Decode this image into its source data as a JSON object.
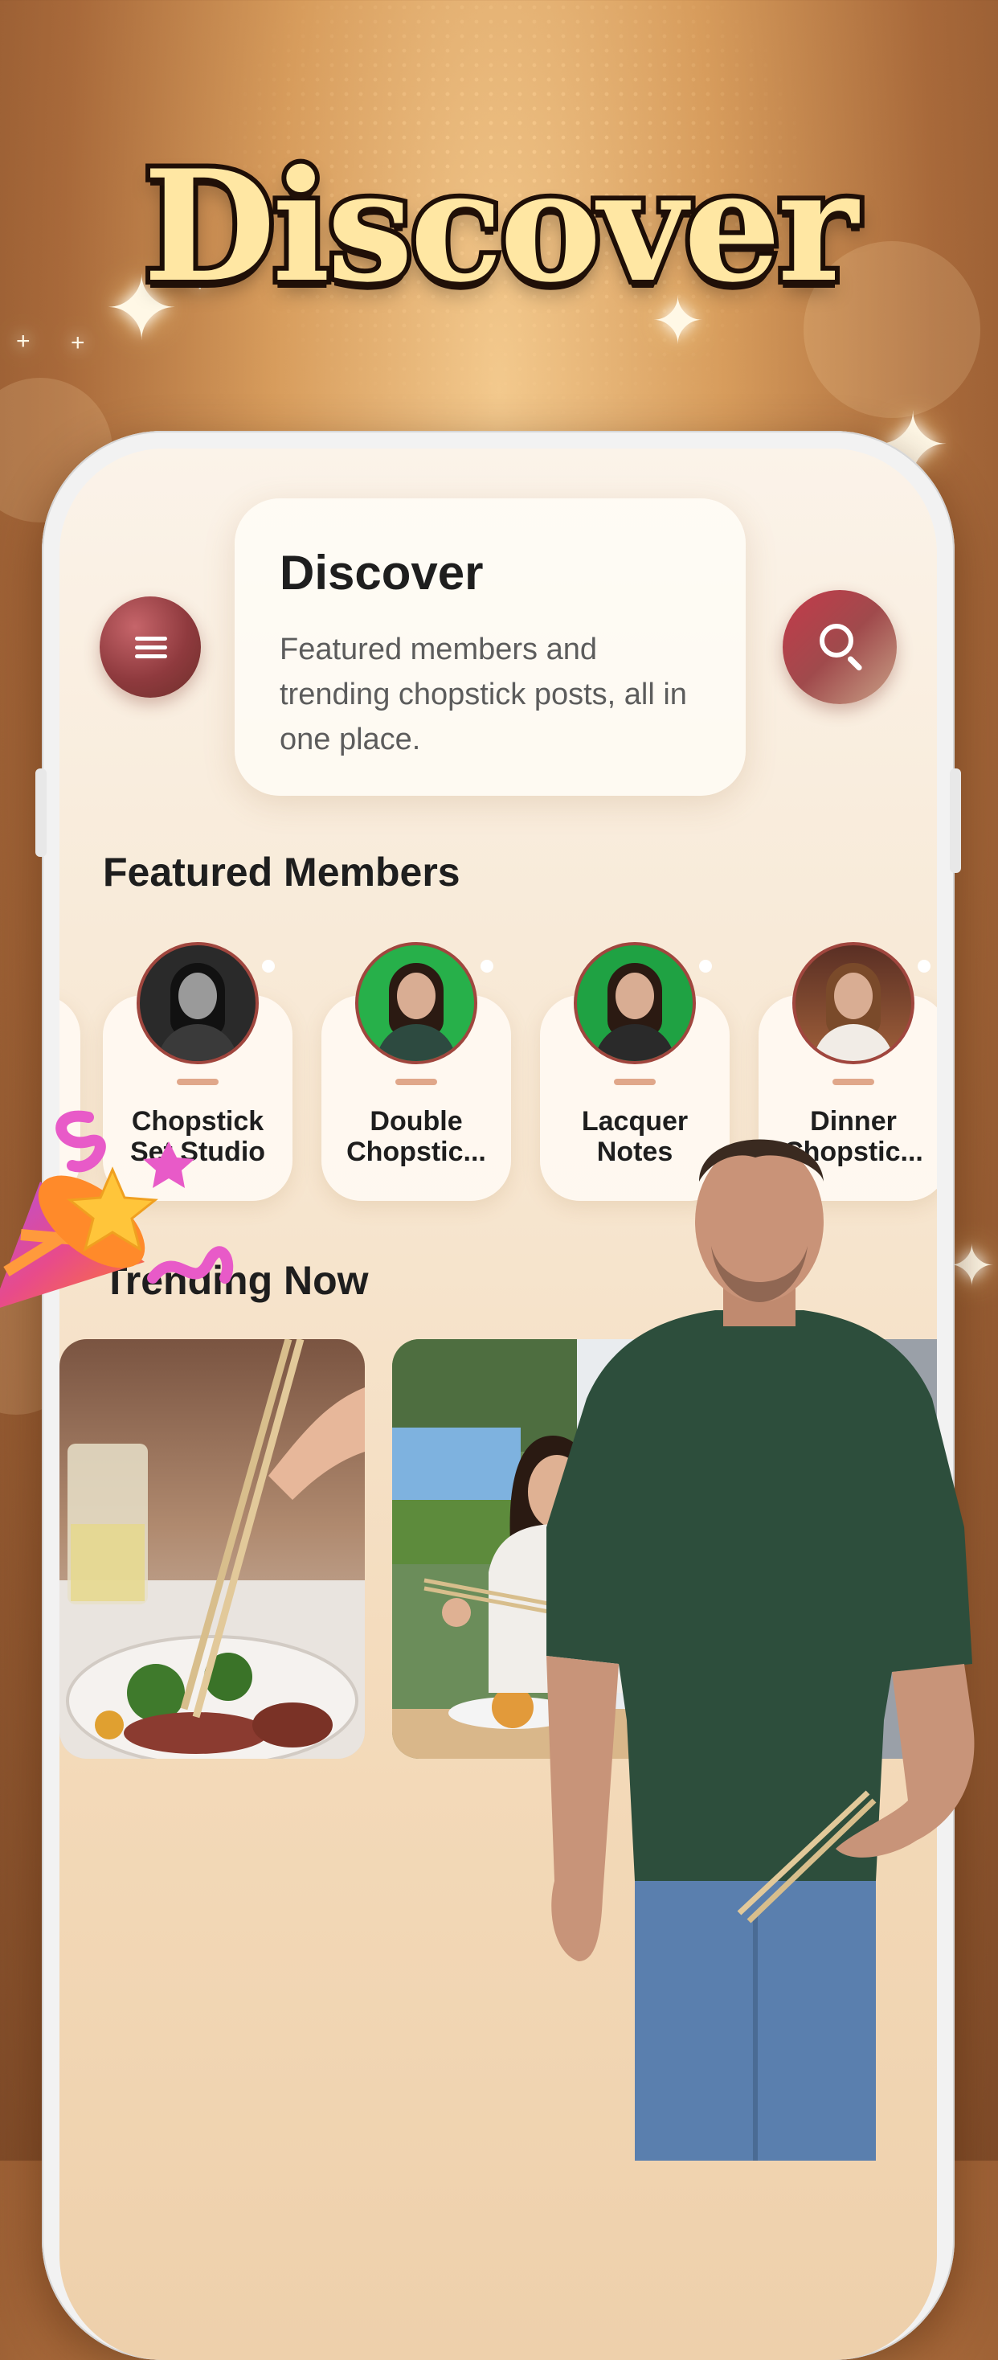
{
  "hero": {
    "title": "Discover"
  },
  "header": {
    "title": "Discover",
    "subtitle": "Featured members and trending chopstick posts, all in one place."
  },
  "featured": {
    "title": "Featured Members",
    "members": [
      {
        "name": "Chopstick\nSet Studio",
        "photo": "black-and-white portrait"
      },
      {
        "name": "Double\nChopstic...",
        "photo": "green-background portrait"
      },
      {
        "name": "Lacquer\nNotes",
        "photo": "green-background portrait eating"
      },
      {
        "name": "Dinner\nChopstic...",
        "photo": "restaurant portrait"
      }
    ]
  },
  "trending": {
    "title": "Trending Now",
    "posts": [
      {
        "photo": "chopsticks lifting food from plate with drink"
      },
      {
        "photo": "woman eating with chopsticks at outdoor table"
      }
    ]
  },
  "icons": {
    "menu": "hamburger-menu-icon",
    "search": "search-icon"
  },
  "colors": {
    "accent": "#9b3a3e",
    "background": "#d79c5c",
    "title_fill": "#ffe7a3",
    "title_outline": "#201008"
  }
}
